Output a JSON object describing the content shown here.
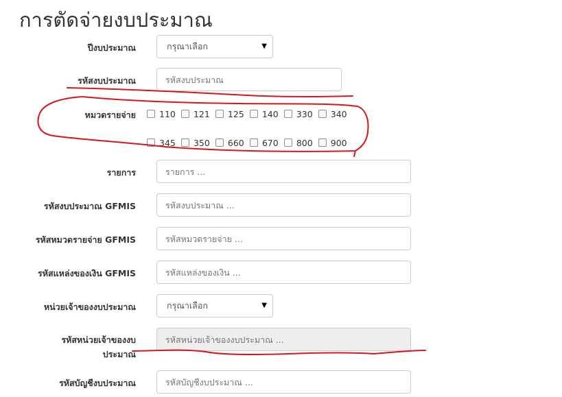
{
  "page": {
    "title": "การตัดจ่ายงบประมาณ"
  },
  "form": {
    "fiscal_year": {
      "label": "ปีงบประมาณ",
      "value": "กรุณาเลือก"
    },
    "budget_code": {
      "label": "รหัสงบประมาณ",
      "placeholder": "รหัสงบประมาณ"
    },
    "expense_category": {
      "label": "หมวดรายจ่าย",
      "row1": [
        "110",
        "121",
        "125",
        "140",
        "330",
        "340"
      ],
      "row2": [
        "345",
        "350",
        "660",
        "670",
        "800",
        "900"
      ]
    },
    "item": {
      "label": "รายการ",
      "placeholder": "รายการ ..."
    },
    "budget_code_gfmis": {
      "label": "รหัสงบประมาณ GFMIS",
      "placeholder": "รหัสงบประมาณ ..."
    },
    "expense_category_gfmis": {
      "label": "รหัสหมวดรายจ่าย GFMIS",
      "placeholder": "รหัสหมวดรายจ่าย ..."
    },
    "fund_source_gfmis": {
      "label": "รหัสแหล่งของเงิน GFMIS",
      "placeholder": "รหัสแหล่งของเงิน ..."
    },
    "budget_owner": {
      "label": "หน่วยเจ้าของงบประมาณ",
      "value": "กรุณาเลือก"
    },
    "budget_owner_code": {
      "label": "รหัสหน่วยเจ้าของงบประมาณ",
      "placeholder": "รหัสหน่วยเจ้าของงบประมาณ ..."
    },
    "budget_account_code": {
      "label": "รหัสบัญชีงบประมาณ",
      "placeholder": "รหัสบัญชีงบประมาณ ..."
    }
  },
  "annotation_color": "#d8141c"
}
